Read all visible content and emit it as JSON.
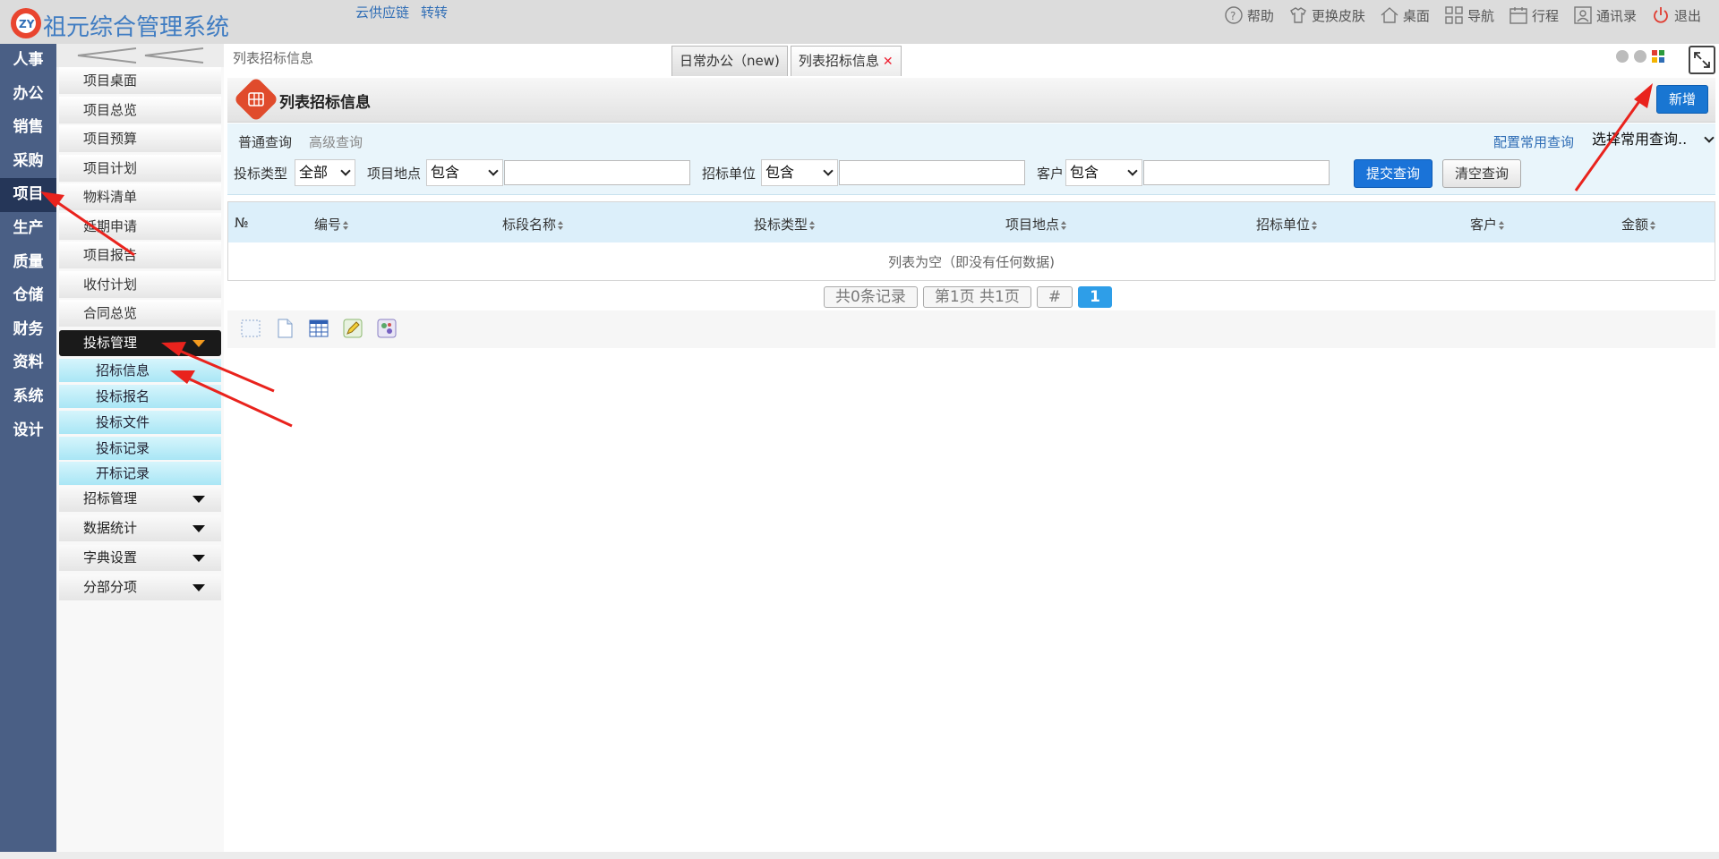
{
  "app": {
    "title": "祖元综合管理系统",
    "top_links": [
      "云供应链",
      "转转"
    ],
    "top_right": [
      {
        "label": "帮助",
        "icon": "help-icon"
      },
      {
        "label": "更换皮肤",
        "icon": "tshirt-icon"
      },
      {
        "label": "桌面",
        "icon": "home-icon"
      },
      {
        "label": "导航",
        "icon": "grid-icon"
      },
      {
        "label": "行程",
        "icon": "calendar-icon"
      },
      {
        "label": "通讯录",
        "icon": "contacts-icon"
      },
      {
        "label": "退出",
        "icon": "power-icon"
      }
    ]
  },
  "left_nav": {
    "items": [
      "人事",
      "办公",
      "销售",
      "采购",
      "项目",
      "生产",
      "质量",
      "仓储",
      "财务",
      "资料",
      "系统",
      "设计"
    ],
    "active": "项目"
  },
  "submenu": {
    "items": [
      "项目桌面",
      "项目总览",
      "项目预算",
      "项目计划",
      "物料清单",
      "延期申请",
      "项目报告",
      "收付计划",
      "合同总览"
    ],
    "open_group": "投标管理",
    "children": [
      "招标信息",
      "投标报名",
      "投标文件",
      "投标记录",
      "开标记录"
    ],
    "groups": [
      "招标管理",
      "数据统计",
      "字典设置",
      "分部分项"
    ]
  },
  "breadcrumb": "列表招标信息",
  "tabs": [
    {
      "label": "日常办公（new)"
    },
    {
      "label": "列表招标信息"
    }
  ],
  "panel": {
    "title": "列表招标信息",
    "add_label": "新增"
  },
  "query": {
    "tab_normal": "普通查询",
    "tab_advanced": "高级查询",
    "config_link": "配置常用查询",
    "saved_select": "选择常用查询..",
    "bid_type_label": "投标类型",
    "bid_type_value": "全部",
    "location_label": "项目地点",
    "location_op": "包含",
    "unit_label": "招标单位",
    "unit_op": "包含",
    "customer_label": "客户",
    "customer_op": "包含",
    "submit_label": "提交查询",
    "clear_label": "清空查询"
  },
  "grid": {
    "columns": [
      "№",
      "编号",
      "标段名称",
      "投标类型",
      "项目地点",
      "招标单位",
      "客户",
      "金额"
    ],
    "empty_text": "列表为空（即没有任何数据)"
  },
  "pager": {
    "total": "共0条记录",
    "page_info": "第1页 共1页",
    "hash": "#",
    "current": "1"
  },
  "colors": {
    "nav_bg": "#4a5f85",
    "nav_active": "#253658",
    "primary": "#1976d2",
    "accent": "#e04b2c"
  }
}
